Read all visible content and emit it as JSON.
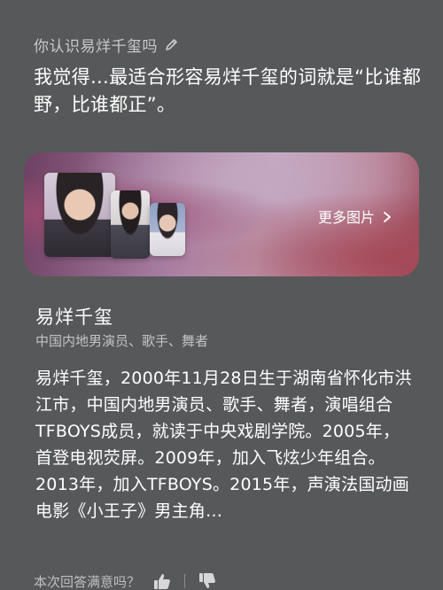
{
  "query": {
    "text": "你认识易烊千玺吗",
    "edit_icon": "pencil-icon"
  },
  "answer": {
    "text": "我觉得…最适合形容易烊千玺的词就是“比谁都野，比谁都正”。"
  },
  "image_card": {
    "more_label": "更多图片",
    "chevron_icon": "chevron-right-icon"
  },
  "entity": {
    "name": "易烊千玺",
    "subtitle": "中国内地男演员、歌手、舞者",
    "description": "易烊千玺，2000年11月28日生于湖南省怀化市洪江市，中国内地男演员、歌手、舞者，演唱组合TFBOYS成员，就读于中央戏剧学院。2005年，首登电视荧屏。2009年，加入飞炫少年组合。2013年，加入TFBOYS。2015年，声演法国动画电影《小王子》男主角…"
  },
  "feedback": {
    "prompt": "本次回答满意吗？",
    "like_icon": "thumbs-up-icon",
    "dislike_icon": "thumbs-down-icon"
  }
}
